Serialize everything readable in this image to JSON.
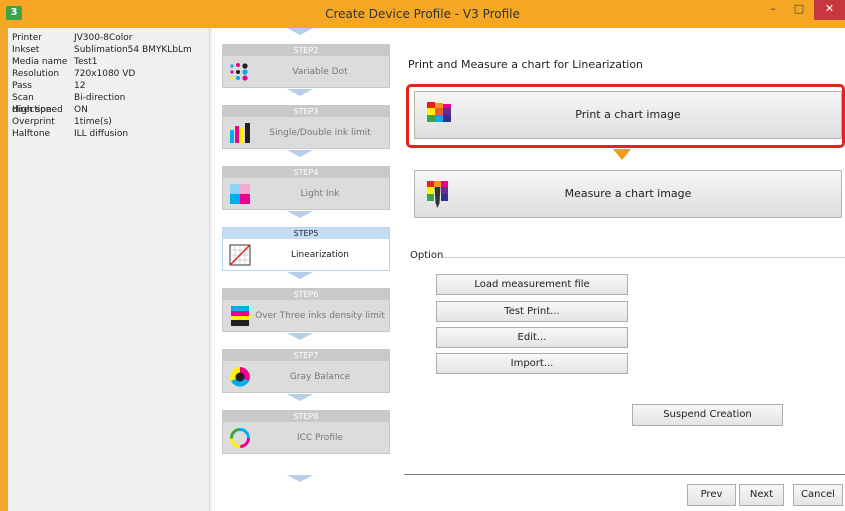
{
  "window": {
    "title": "Create Device Profile - V3 Profile",
    "app_icon_glyph": "3"
  },
  "info": [
    {
      "label": "Printer",
      "value": "JV300-8Color"
    },
    {
      "label": "Inkset",
      "value": "Sublimation54 BMYKLbLm"
    },
    {
      "label": "Media name",
      "value": "Test1"
    },
    {
      "label": "Resolution",
      "value": "720x1080 VD"
    },
    {
      "label": "Pass",
      "value": "12"
    },
    {
      "label": "Scan direction",
      "value": "Bi-direction"
    },
    {
      "label": "High speed",
      "value": "ON"
    },
    {
      "label": "Overprint",
      "value": "1time(s)"
    },
    {
      "label": "Halftone",
      "value": "ILL diffusion"
    }
  ],
  "steps": [
    {
      "head": "STEP2",
      "name": "Variable Dot",
      "icon": "variable-dot-icon"
    },
    {
      "head": "STEP3",
      "name": "Single/Double ink limit",
      "icon": "ink-limit-icon"
    },
    {
      "head": "STEP4",
      "name": "Light Ink",
      "icon": "light-ink-icon"
    },
    {
      "head": "STEP5",
      "name": "Linearization",
      "icon": "linearization-icon",
      "active": true
    },
    {
      "head": "STEP6",
      "name": "Over Three inks density limit",
      "icon": "density-limit-icon"
    },
    {
      "head": "STEP7",
      "name": "Gray Balance",
      "icon": "gray-balance-icon"
    },
    {
      "head": "STEP8",
      "name": "ICC Profile",
      "icon": "icc-profile-icon"
    }
  ],
  "main": {
    "heading": "Print and Measure a chart for Linearization",
    "print_label": "Print a chart image",
    "measure_label": "Measure a chart image",
    "option_label": "Option",
    "options": [
      "Load measurement file",
      "Test Print...",
      "Edit...",
      "Import..."
    ],
    "suspend_label": "Suspend Creation",
    "prev_label": "Prev",
    "next_label": "Next",
    "cancel_label": "Cancel"
  },
  "colors": {
    "accent": "#f5a623",
    "highlight": "#e2231a",
    "active_step": "#c5dcf5",
    "arrow": "#f39a1d"
  }
}
